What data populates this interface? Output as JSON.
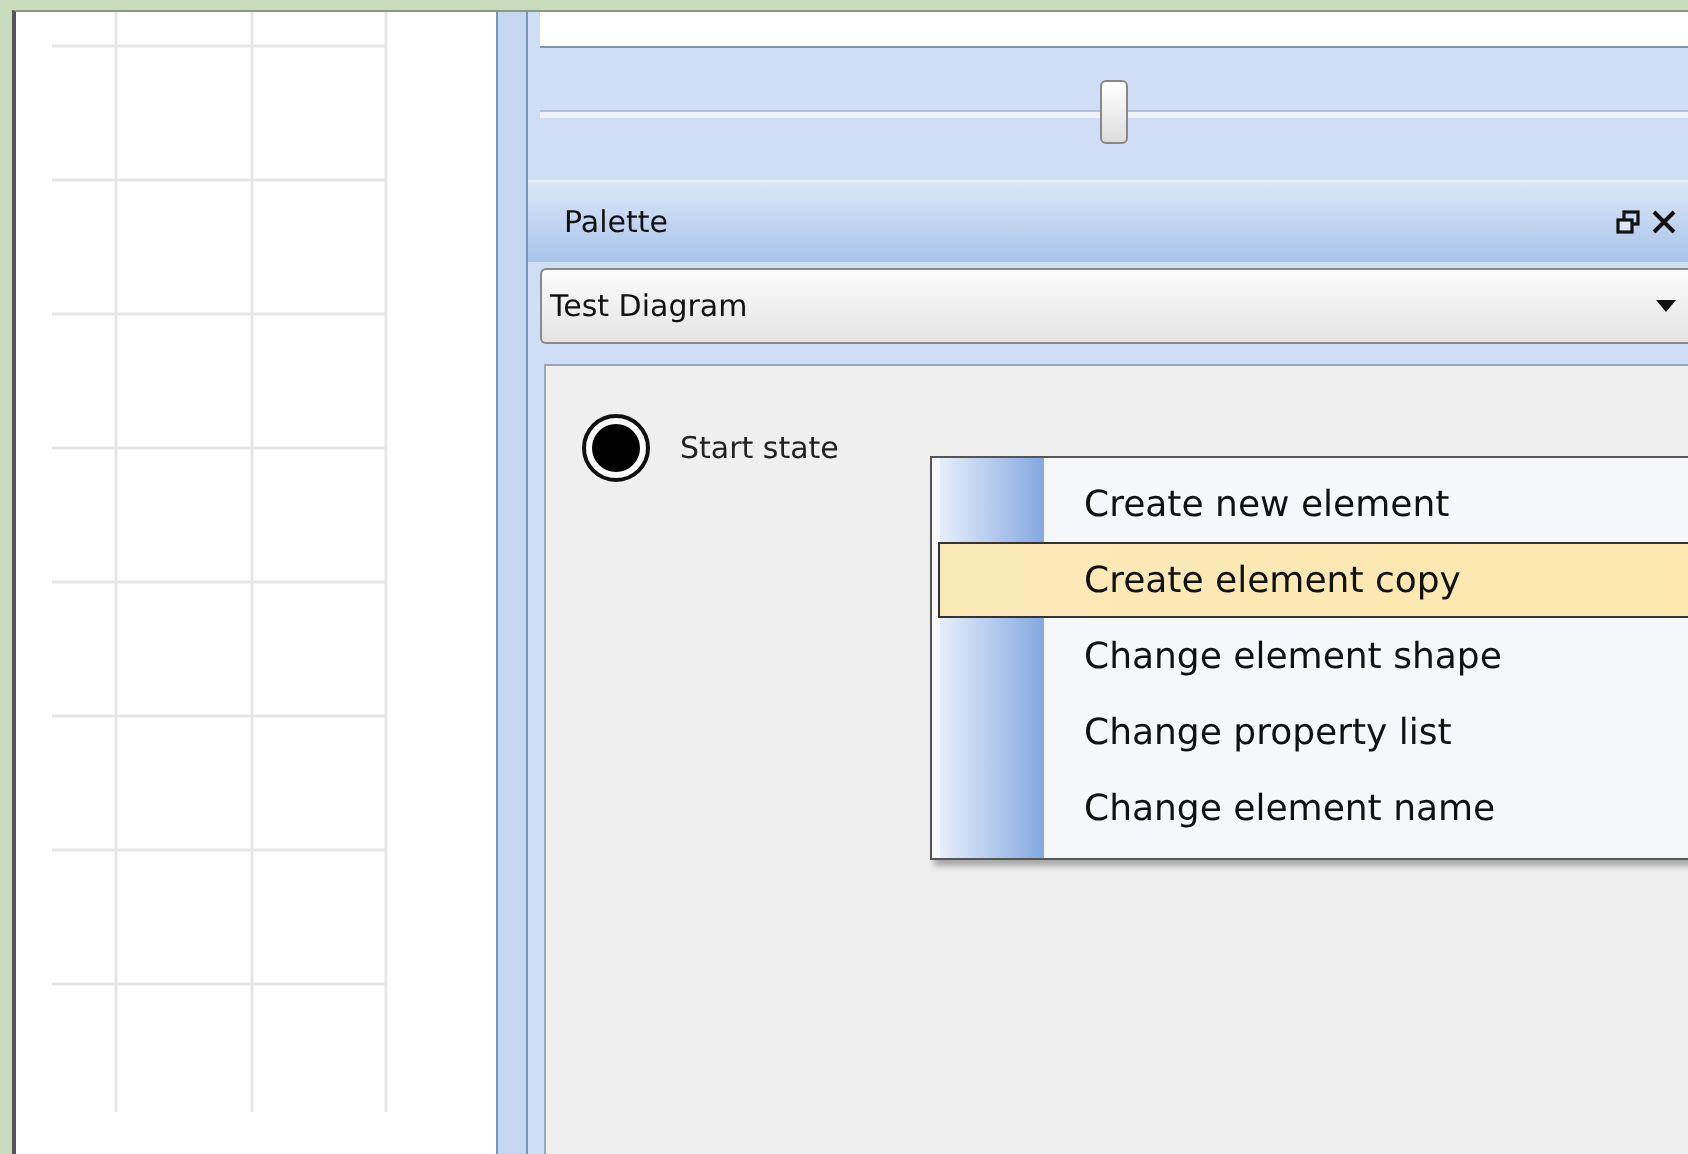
{
  "zoom_slider": {
    "level": 0.5
  },
  "palette": {
    "title": "Palette",
    "diagram": "Test Diagram",
    "items": [
      {
        "kind": "start",
        "label": "Start state"
      }
    ]
  },
  "context_menu": {
    "items": [
      {
        "label": "Create new element",
        "selected": false
      },
      {
        "label": "Create element copy",
        "selected": true
      },
      {
        "label": "Change element shape",
        "selected": false
      },
      {
        "label": "Change property list",
        "selected": false
      },
      {
        "label": "Change element name",
        "selected": false
      }
    ]
  }
}
